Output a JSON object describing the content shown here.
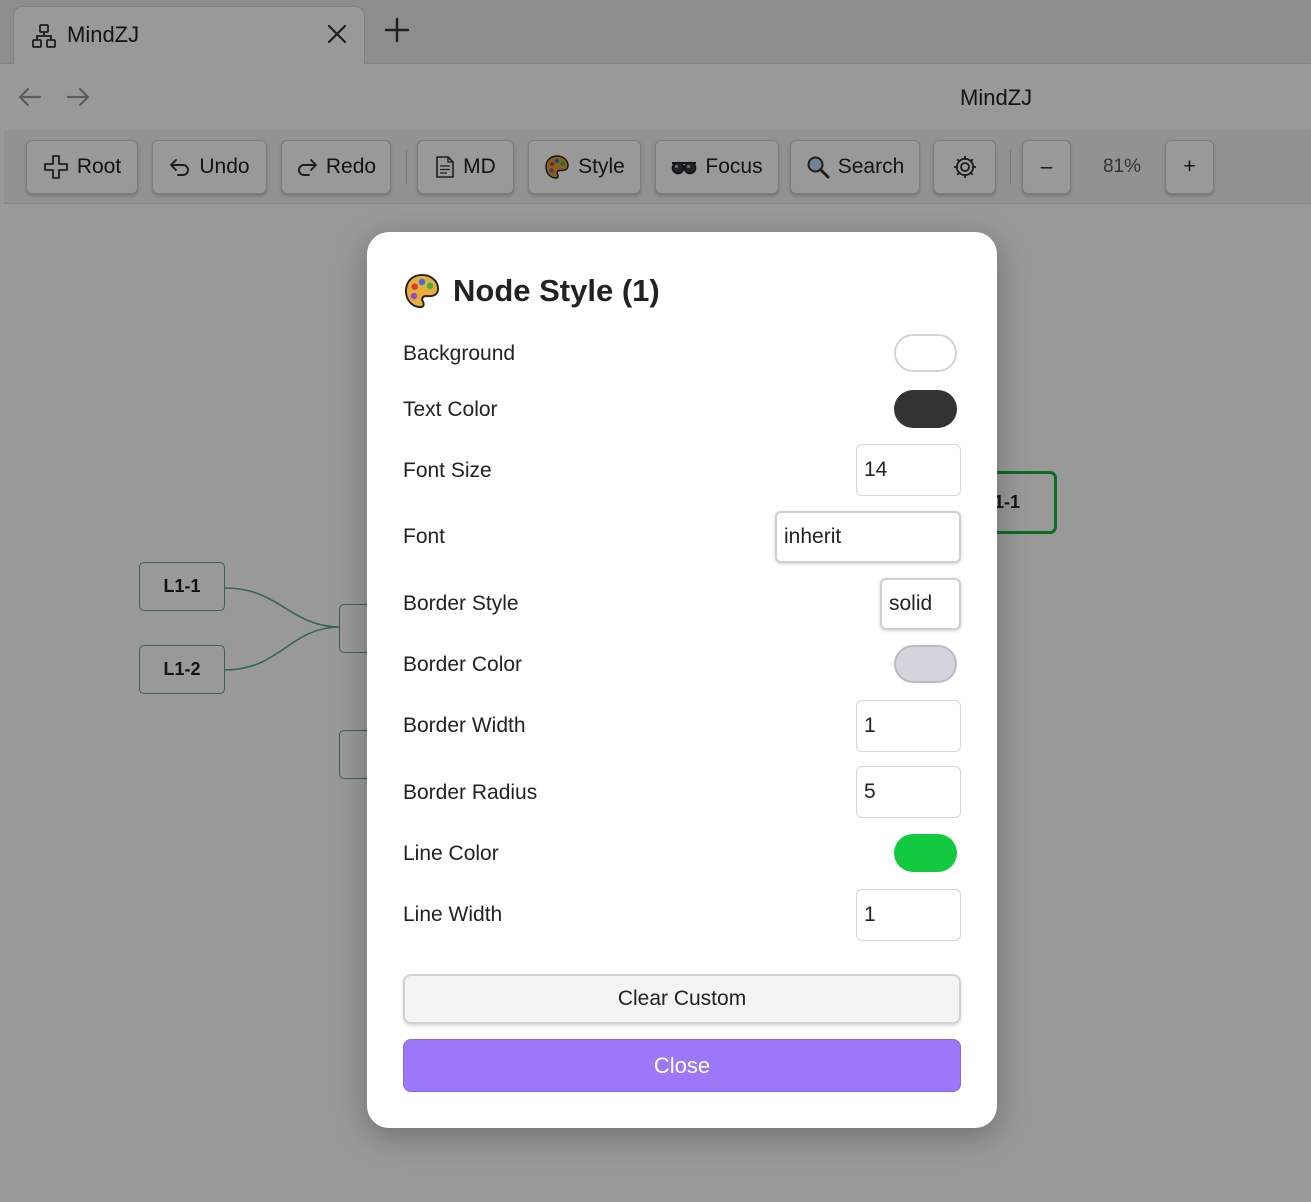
{
  "tab": {
    "title": "MindZJ",
    "icon": "sitemap-icon",
    "close_icon": "close-icon"
  },
  "new_tab_icon": "plus-icon",
  "nav": {
    "back_icon": "arrow-left-icon",
    "forward_icon": "arrow-right-icon",
    "view_title": "MindZJ"
  },
  "toolbar": {
    "root": "Root",
    "undo": "Undo",
    "redo": "Redo",
    "md": "MD",
    "style": "Style",
    "focus": "Focus",
    "search": "Search",
    "settings_icon": "gear-icon",
    "zoom_out": "–",
    "zoom_level": "81%",
    "zoom_in": "+"
  },
  "canvas": {
    "nodes": [
      {
        "label": "L1-1"
      },
      {
        "label": "L1-2"
      },
      {
        "label": "1-1"
      }
    ],
    "branch_color": "#5aa79a",
    "selected_color": "#13b83d"
  },
  "modal": {
    "icon": "palette-icon",
    "title": "Node Style (1)",
    "background": {
      "label": "Background",
      "color": "#ffffff"
    },
    "text_color": {
      "label": "Text Color",
      "color": "#333333"
    },
    "font_size": {
      "label": "Font Size",
      "value": "14"
    },
    "font": {
      "label": "Font",
      "value": "inherit"
    },
    "border_style": {
      "label": "Border Style",
      "value": "solid"
    },
    "border_color": {
      "label": "Border Color",
      "color": "#d3d5dd"
    },
    "border_width": {
      "label": "Border Width",
      "value": "1"
    },
    "border_radius": {
      "label": "Border Radius",
      "value": "5"
    },
    "line_color": {
      "label": "Line Color",
      "color": "#12c93f"
    },
    "line_width": {
      "label": "Line Width",
      "value": "1"
    },
    "clear_label": "Clear Custom",
    "close_label": "Close",
    "close_color": "#9b78f7"
  }
}
